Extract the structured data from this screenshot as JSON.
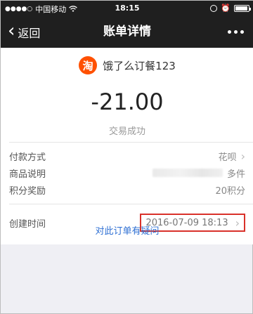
{
  "status_bar": {
    "signal": "●●●●○",
    "carrier": "中国移动",
    "time": "18:15",
    "alarm_icon": "⏰"
  },
  "nav": {
    "back_icon": "‹",
    "back_label": "返回",
    "title": "账单详情",
    "more_icon": "more-dots-icon"
  },
  "merchant": {
    "logo_char": "淘",
    "name": "饿了么订餐123",
    "brand_color": "#ff5000"
  },
  "amount": "-21.00",
  "trade_status": "交易成功",
  "details": [
    {
      "label": "付款方式",
      "value": "花呗",
      "chevron": "›"
    },
    {
      "label": "商品说明",
      "value": "多件",
      "chevron": ""
    },
    {
      "label": "积分奖励",
      "value": "20积分",
      "chevron": ""
    }
  ],
  "created": {
    "label": "创建时间",
    "value": "2016-07-09 18:13",
    "chevron": "›",
    "highlight_color": "#d9312a"
  },
  "question_link": "对此订单有疑问",
  "colors": {
    "nav_bg": "#1f1f1f",
    "page_bg": "#efeff4",
    "link": "#2e6fd3"
  }
}
